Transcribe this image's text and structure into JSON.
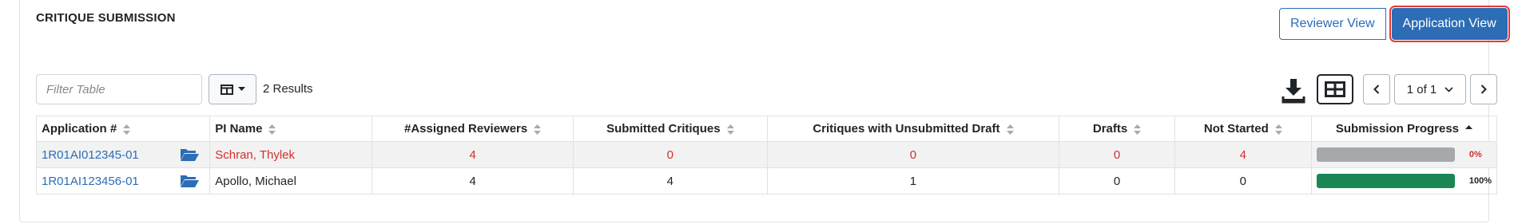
{
  "header": {
    "title": "CRITIQUE SUBMISSION"
  },
  "view_toggle": {
    "reviewer_label": "Reviewer View",
    "application_label": "Application View"
  },
  "toolbar": {
    "filter_placeholder": "Filter Table",
    "results": "2 Results",
    "page_select": "1 of 1",
    "icons": [
      "table-columns-icon",
      "chevron-down-icon",
      "download-icon",
      "grid-view-icon",
      "chevron-left-icon",
      "chevron-right-icon"
    ]
  },
  "table": {
    "columns": [
      "Application #",
      "PI Name",
      "#Assigned Reviewers",
      "Submitted Critiques",
      "Critiques with Unsubmitted Draft",
      "Drafts",
      "Not Started",
      "Submission Progress"
    ],
    "rows": [
      {
        "application": "1R01AI012345-01",
        "pi_name": "Schran, Thylek",
        "assigned": "4",
        "submitted": "0",
        "unsubmitted_draft": "0",
        "drafts": "0",
        "not_started": "4",
        "progress": 0,
        "progress_label": "0%",
        "highlight": "red"
      },
      {
        "application": "1R01AI123456-01",
        "pi_name": "Apollo, Michael",
        "assigned": "4",
        "submitted": "4",
        "unsubmitted_draft": "1",
        "drafts": "0",
        "not_started": "0",
        "progress": 1,
        "progress_label": "100%",
        "highlight": "none"
      }
    ]
  },
  "colors": {
    "primary": "#2c6db6",
    "alert_red": "#d32f2f",
    "progress_complete": "#1a8754",
    "progress_empty": "#a6a9ac",
    "highlight_border": "#e53935"
  }
}
